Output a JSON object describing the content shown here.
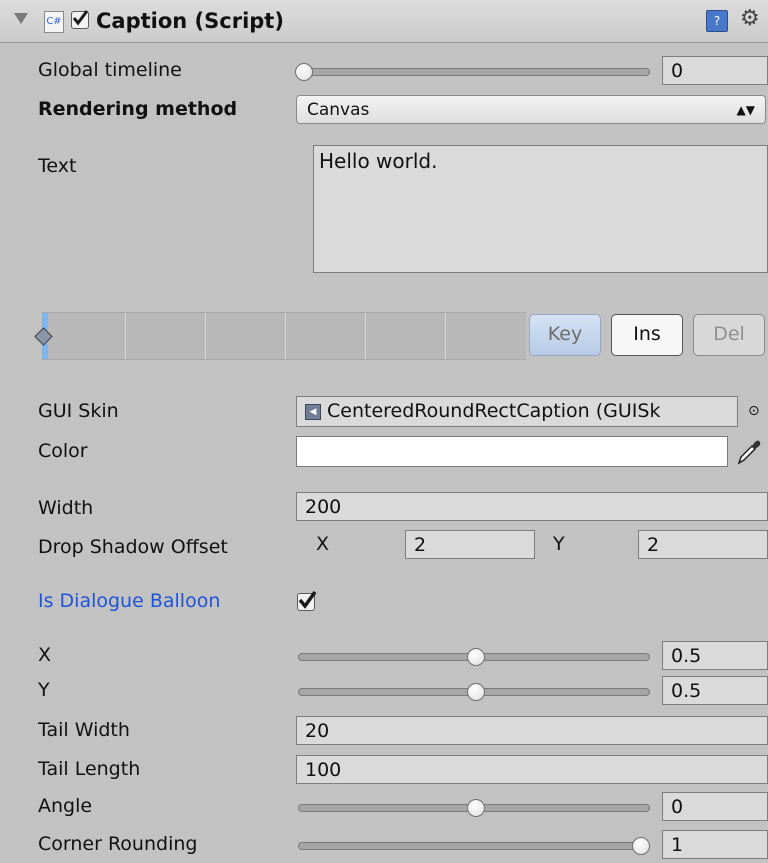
{
  "header": {
    "title": "Caption (Script)",
    "enabled": true,
    "icons": [
      "foldout-arrow-icon",
      "csharp-script-icon",
      "help-book-icon",
      "gear-icon"
    ]
  },
  "fields": {
    "global_timeline": {
      "label": "Global timeline",
      "value": "0",
      "slider_fraction": 0.0
    },
    "rendering_method": {
      "label": "Rendering method",
      "selected": "Canvas"
    },
    "text": {
      "label": "Text",
      "value": "Hello world."
    },
    "gui_skin": {
      "label": "GUI Skin",
      "value": "CenteredRoundRectCaption (GUISk"
    },
    "color": {
      "label": "Color",
      "value": "#ffffff"
    },
    "width": {
      "label": "Width",
      "value": "200"
    },
    "drop_shadow": {
      "label": "Drop Shadow Offset",
      "x_label": "X",
      "x": "2",
      "y_label": "Y",
      "y": "2"
    },
    "is_dialogue_balloon": {
      "label": "Is Dialogue Balloon",
      "checked": true
    },
    "x": {
      "label": "X",
      "value": "0.5",
      "slider_fraction": 0.5
    },
    "y": {
      "label": "Y",
      "value": "0.5",
      "slider_fraction": 0.5
    },
    "tail_width": {
      "label": "Tail Width",
      "value": "20"
    },
    "tail_length": {
      "label": "Tail Length",
      "value": "100"
    },
    "angle": {
      "label": "Angle",
      "value": "0",
      "slider_fraction": 0.5
    },
    "corner_rounding": {
      "label": "Corner Rounding",
      "value": "1",
      "slider_fraction": 1.0
    }
  },
  "keyframe_buttons": {
    "key": "Key",
    "ins": "Ins",
    "del": "Del"
  },
  "colors": {
    "panel": "#c2c2c2",
    "accent_blue": "#1f54d6"
  }
}
